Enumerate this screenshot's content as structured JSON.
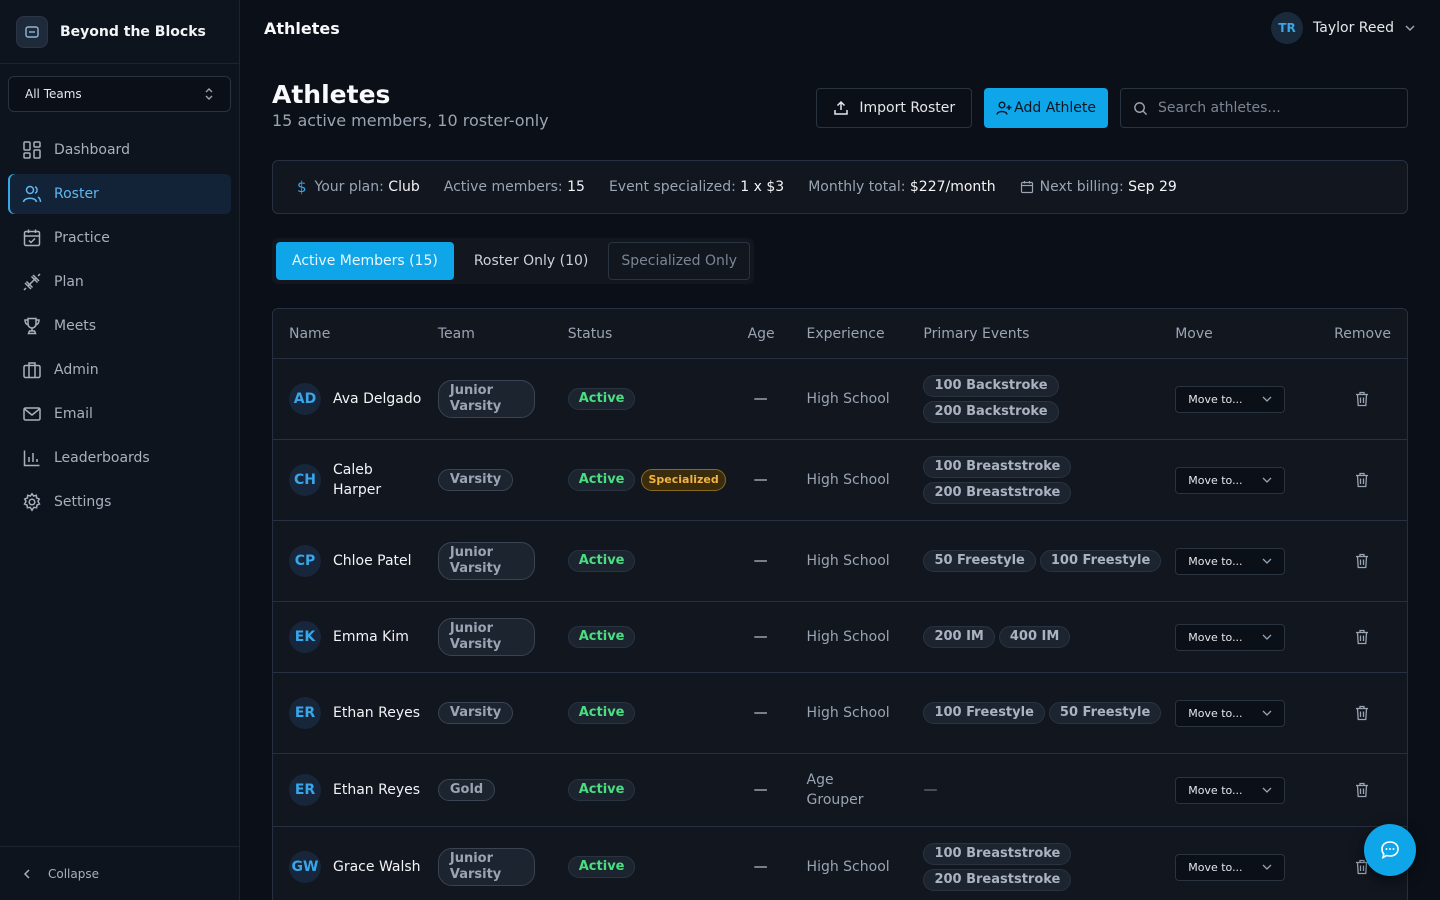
{
  "app": {
    "name": "Beyond the Blocks"
  },
  "sidebar": {
    "team_select": "All Teams",
    "items": [
      {
        "label": "Dashboard",
        "icon": "dashboard-icon"
      },
      {
        "label": "Roster",
        "icon": "users-icon",
        "active": true
      },
      {
        "label": "Practice",
        "icon": "calendar-check-icon"
      },
      {
        "label": "Plan",
        "icon": "dumbbell-icon"
      },
      {
        "label": "Meets",
        "icon": "trophy-icon"
      },
      {
        "label": "Admin",
        "icon": "briefcase-icon"
      },
      {
        "label": "Email",
        "icon": "mail-icon"
      },
      {
        "label": "Leaderboards",
        "icon": "bar-chart-icon"
      },
      {
        "label": "Settings",
        "icon": "gear-icon"
      }
    ],
    "collapse_label": "Collapse"
  },
  "header": {
    "title": "Athletes",
    "user": {
      "initials": "TR",
      "name": "Taylor Reed"
    }
  },
  "page": {
    "title": "Athletes",
    "subtitle": "15 active members, 10 roster-only",
    "import_label": "Import Roster",
    "add_label": "Add Athlete",
    "search_placeholder": "Search athletes..."
  },
  "plan": {
    "plan_label": "Your plan:",
    "plan_value": "Club",
    "active_label": "Active members:",
    "active_value": "15",
    "event_label": "Event specialized:",
    "event_value": "1 x $3",
    "monthly_label": "Monthly total:",
    "monthly_value": "$227/month",
    "billing_label": "Next billing:",
    "billing_value": "Sep 29"
  },
  "tabs": [
    {
      "label": "Active Members (15)",
      "active": true
    },
    {
      "label": "Roster Only (10)"
    },
    {
      "label": "Specialized Only"
    }
  ],
  "table": {
    "headers": [
      "Name",
      "Team",
      "Status",
      "Age",
      "Experience",
      "Primary Events",
      "Move",
      "Remove"
    ],
    "move_label": "Move to...",
    "rows": [
      {
        "initials": "AD",
        "name": "Ava Delgado",
        "team": "Junior Varsity",
        "status": "Active",
        "age": "—",
        "experience": "High School",
        "events": [
          "100 Backstroke",
          "200 Backstroke"
        ]
      },
      {
        "initials": "CH",
        "name": "Caleb Harper",
        "team": "Varsity",
        "status": "Active",
        "specialized": "Specialized",
        "age": "—",
        "experience": "High School",
        "events": [
          "100 Breaststroke",
          "200 Breaststroke"
        ]
      },
      {
        "initials": "CP",
        "name": "Chloe Patel",
        "team": "Junior Varsity",
        "status": "Active",
        "age": "—",
        "experience": "High School",
        "events": [
          "50 Freestyle",
          "100 Freestyle"
        ]
      },
      {
        "initials": "EK",
        "name": "Emma Kim",
        "team": "Junior Varsity",
        "status": "Active",
        "age": "—",
        "experience": "High School",
        "events": [
          "200 IM",
          "400 IM"
        ]
      },
      {
        "initials": "ER",
        "name": "Ethan Reyes",
        "team": "Varsity",
        "status": "Active",
        "age": "—",
        "experience": "High School",
        "events": [
          "100 Freestyle",
          "50 Freestyle"
        ]
      },
      {
        "initials": "ER",
        "name": "Ethan Reyes",
        "team": "Gold",
        "status": "Active",
        "age": "—",
        "experience": "Age Grouper",
        "events_empty": "—"
      },
      {
        "initials": "GW",
        "name": "Grace Walsh",
        "team": "Junior Varsity",
        "status": "Active",
        "age": "—",
        "experience": "High School",
        "events": [
          "100 Breaststroke",
          "200 Breaststroke"
        ]
      }
    ]
  },
  "colors": {
    "accent": "#0ea5e9",
    "active_green": "#4ade80",
    "specialized": "#f2b441",
    "background": "#0b0f17"
  }
}
